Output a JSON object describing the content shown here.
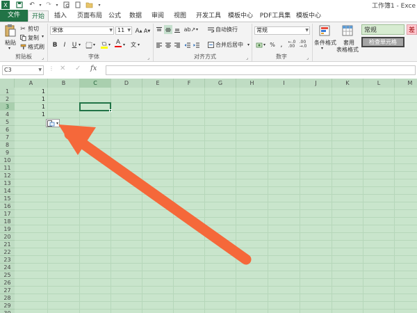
{
  "title": "工作簿1 - Exce",
  "tabs": [
    "文件",
    "开始",
    "插入",
    "页面布局",
    "公式",
    "数据",
    "审阅",
    "视图",
    "开发工具",
    "模板中心",
    "PDF工具集",
    "模板中心"
  ],
  "clipboard": {
    "paste": "粘贴",
    "cut": "剪切",
    "copy": "复制",
    "format_painter": "格式刷",
    "label": "剪贴板"
  },
  "font": {
    "name": "宋体",
    "size": "11",
    "bold": "B",
    "italic": "I",
    "underline": "U",
    "grow": "A",
    "shrink": "A",
    "font_color": "A",
    "label": "字体"
  },
  "alignment": {
    "wrap_text": "自动换行",
    "merge_center": "合并后居中",
    "label": "对齐方式"
  },
  "number": {
    "format": "常规",
    "label": "数字"
  },
  "styles": {
    "conditional_format_line1": "条件格式",
    "table_format_line1": "套用",
    "table_format_line2": "表格格式",
    "style_normal": "常规",
    "style_check_cell": "检查单元格",
    "style_bad": "差"
  },
  "formula_bar": {
    "name_box": "C3",
    "fx": "fx",
    "cancel": "✕",
    "enter": "✓"
  },
  "columns": [
    "A",
    "B",
    "C",
    "D",
    "E",
    "F",
    "G",
    "H",
    "I",
    "J",
    "K",
    "L",
    "M"
  ],
  "rows": [
    "1",
    "2",
    "3",
    "4",
    "5",
    "6",
    "7",
    "8",
    "9",
    "10",
    "11",
    "12",
    "13",
    "14",
    "15",
    "16",
    "17",
    "18",
    "19",
    "20",
    "21",
    "22",
    "23",
    "24",
    "25",
    "26",
    "27",
    "28",
    "29",
    "30"
  ],
  "cells": [
    {
      "ref": "A1",
      "value": "1"
    },
    {
      "ref": "A2",
      "value": "1"
    },
    {
      "ref": "A3",
      "value": "1"
    },
    {
      "ref": "A4",
      "value": "1"
    }
  ],
  "selected_cell": "C3",
  "colors": {
    "excel_green": "#217346",
    "sheet_bg": "#c9e5cc",
    "annotation_arrow": "#f5683a"
  }
}
